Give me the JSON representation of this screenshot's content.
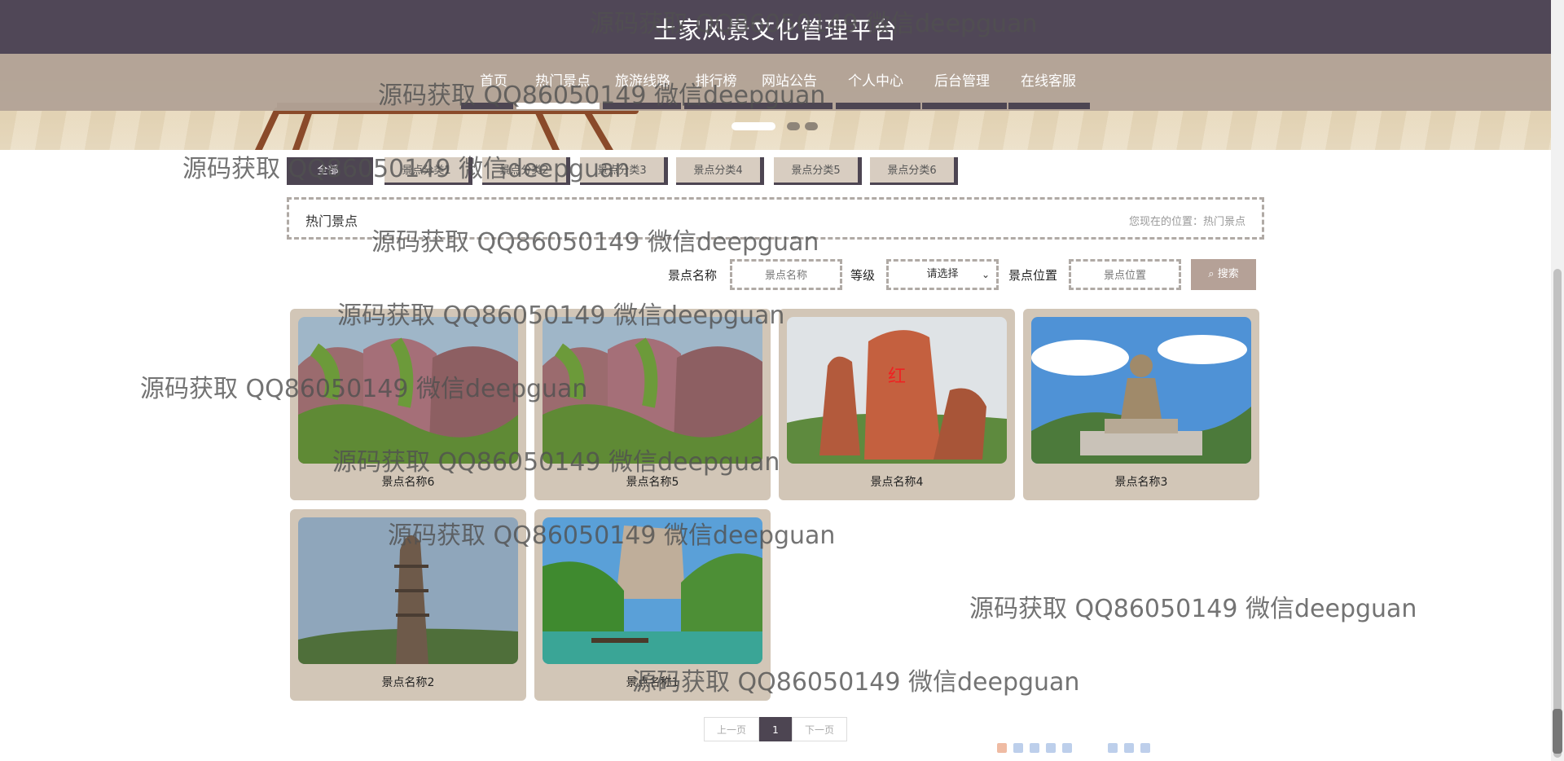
{
  "site": {
    "title": "土家风景文化管理平台"
  },
  "nav": {
    "items": [
      {
        "label": "首页"
      },
      {
        "label": "热门景点"
      },
      {
        "label": "旅游线路"
      },
      {
        "label": "排行榜"
      },
      {
        "label": "网站公告"
      },
      {
        "label": "个人中心"
      },
      {
        "label": "后台管理"
      },
      {
        "label": "在线客服"
      }
    ],
    "active_index": 1
  },
  "categories": {
    "items": [
      {
        "label": "全部"
      },
      {
        "label": "景点分类1"
      },
      {
        "label": "景点分类2"
      },
      {
        "label": "景点分类3"
      },
      {
        "label": "景点分类4"
      },
      {
        "label": "景点分类5"
      },
      {
        "label": "景点分类6"
      }
    ],
    "active_index": 0
  },
  "breadcrumb": {
    "title": "热门景点",
    "location": "您现在的位置：热门景点"
  },
  "search": {
    "name_label": "景点名称",
    "name_placeholder": "景点名称",
    "level_label": "等级",
    "level_selected": "请选择",
    "location_label": "景点位置",
    "location_placeholder": "景点位置",
    "button_label": "搜索",
    "button_icon": "search-icon"
  },
  "spots": [
    {
      "name": "景点名称6",
      "scene": "red-cliff"
    },
    {
      "name": "景点名称5",
      "scene": "red-cliff"
    },
    {
      "name": "景点名称4",
      "scene": "red-rock"
    },
    {
      "name": "景点名称3",
      "scene": "buddha"
    },
    {
      "name": "景点名称2",
      "scene": "rock-pillar"
    },
    {
      "name": "景点名称1",
      "scene": "river-boat"
    }
  ],
  "pagination": {
    "prev": "上一页",
    "current": "1",
    "next": "下一页"
  },
  "watermark": {
    "text": "源码获取 QQ86050149 微信deepguan"
  },
  "colors": {
    "header": "#504757",
    "nav": "#b2a296",
    "accent": "#4d4552",
    "card": "#d2c6b7",
    "button": "#b5a197"
  }
}
